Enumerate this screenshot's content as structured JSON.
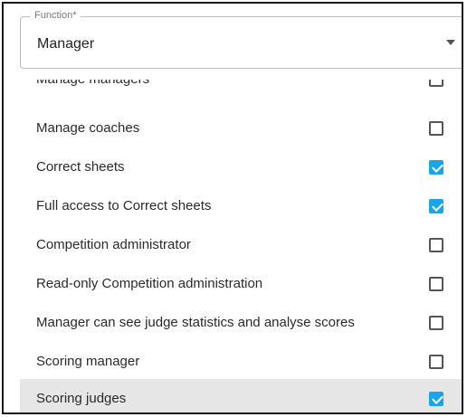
{
  "select": {
    "legend": "Function*",
    "value": "Manager"
  },
  "permissions": [
    {
      "label": "Manage managers",
      "checked": false
    },
    {
      "label": "Manage coaches",
      "checked": false
    },
    {
      "label": "Correct sheets",
      "checked": true
    },
    {
      "label": "Full access to Correct sheets",
      "checked": true
    },
    {
      "label": "Competition administrator",
      "checked": false
    },
    {
      "label": "Read-only Competition administration",
      "checked": false
    },
    {
      "label": "Manager can see judge statistics and analyse scores",
      "checked": false
    },
    {
      "label": "Scoring manager",
      "checked": false
    },
    {
      "label": "Scoring judges",
      "checked": true
    }
  ],
  "colors": {
    "accent": "#1aa6e6",
    "highlight_row": "#e6e6e6"
  }
}
